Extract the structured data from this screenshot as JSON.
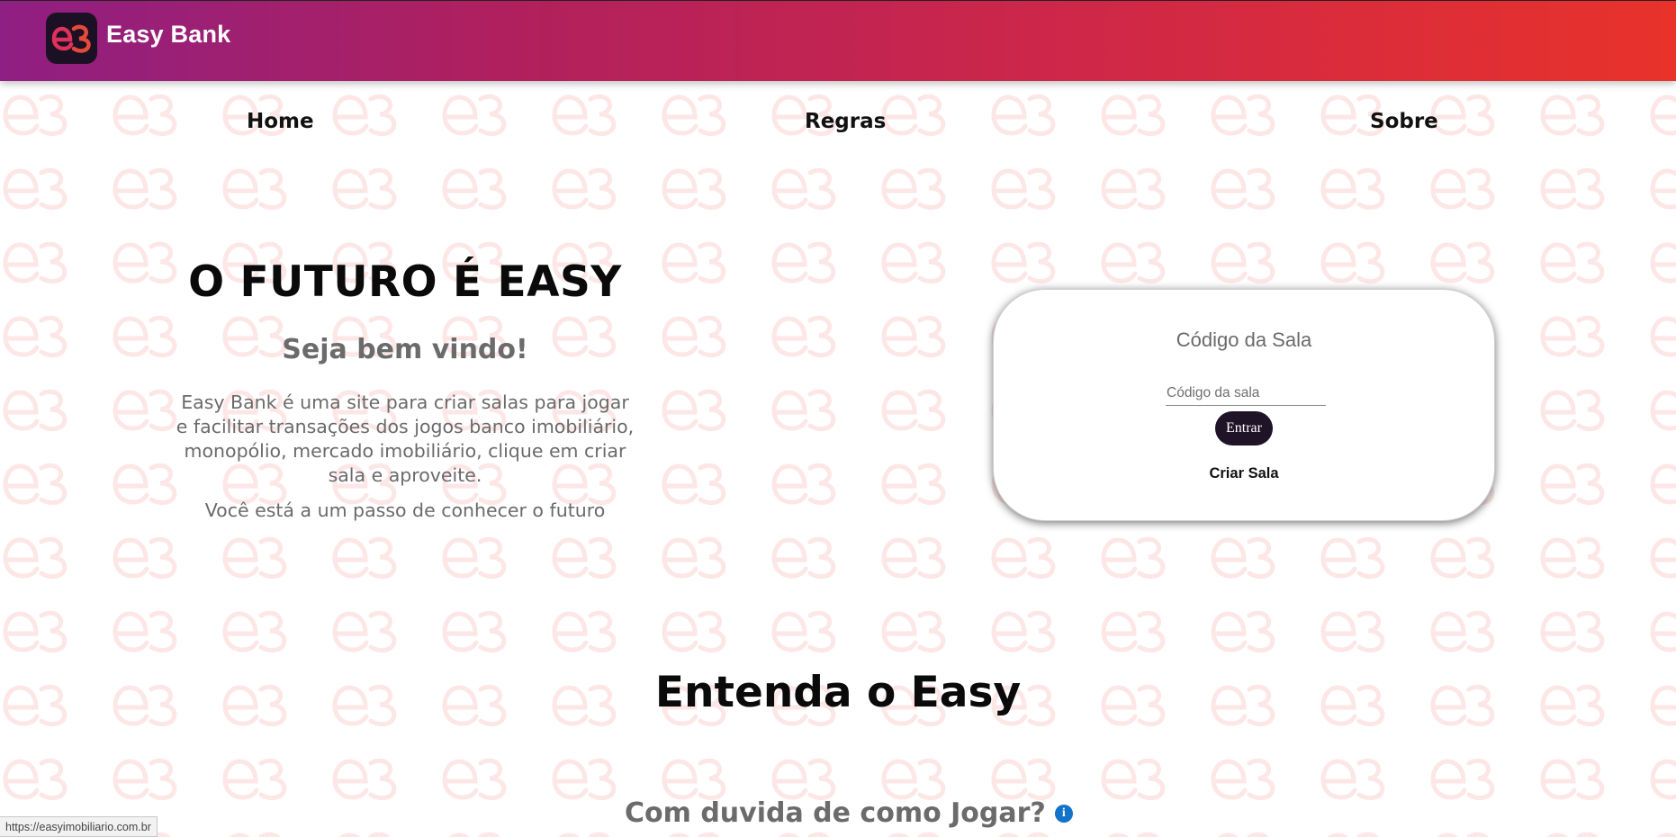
{
  "brand": {
    "name": "Easy Bank",
    "logo_icon": "eb-logo-icon"
  },
  "colors": {
    "header_gradient": [
      "#8f1f82",
      "#b0205e",
      "#cf2748",
      "#e8322a"
    ],
    "button_bg": "#1f1327",
    "watermark": "#fbdcdc",
    "info_icon": "#1273c9"
  },
  "nav": {
    "home": "Home",
    "regras": "Regras",
    "sobre": "Sobre"
  },
  "hero": {
    "title": "O FUTURO É EASY",
    "subtitle": "Seja bem vindo!",
    "description": "Easy Bank é uma site para criar salas para jogar e facilitar transações dos jogos banco imobiliário, monopólio, mercado imobiliário, clique em criar sala e aproveite.",
    "tagline": "Você está a um passo de conhecer o futuro"
  },
  "room": {
    "title": "Código da Sala",
    "input_value": "",
    "input_placeholder": "Código da sala",
    "enter_label": "Entrar",
    "create_label": "Criar Sala"
  },
  "section": {
    "title": "Entenda o Easy",
    "faq_title": "Com duvida de como Jogar?",
    "info_icon": "info-icon"
  },
  "status_bar": {
    "url": "https://easyimobiliario.com.br"
  }
}
